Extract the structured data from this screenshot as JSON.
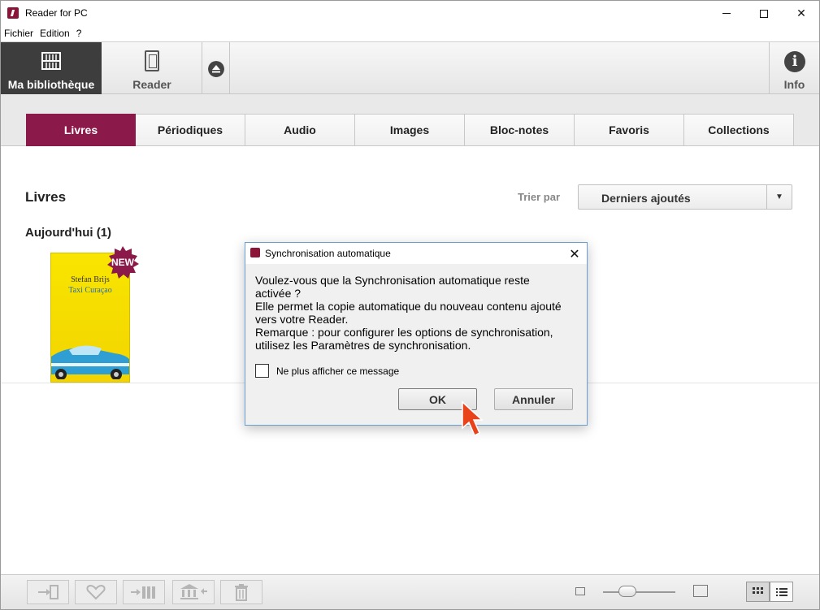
{
  "window": {
    "title": "Reader for PC"
  },
  "menu": {
    "items": [
      "Fichier",
      "Edition",
      "?"
    ]
  },
  "toolbar": {
    "library_label": "Ma bibliothèque",
    "reader_label": "Reader",
    "info_label": "Info"
  },
  "tabs": [
    "Livres",
    "Périodiques",
    "Audio",
    "Images",
    "Bloc-notes",
    "Favoris",
    "Collections"
  ],
  "content": {
    "section_title": "Livres",
    "sort_label": "Trier par",
    "sort_value": "Derniers ajoutés",
    "group_title": "Aujourd'hui (1)",
    "book": {
      "author": "Stefan Brijs",
      "title": "Taxi Curaçao",
      "badge": "NEW"
    }
  },
  "dialog": {
    "title": "Synchronisation automatique",
    "lines": [
      "Voulez-vous que la Synchronisation automatique reste",
      "activée ?",
      "Elle permet la copie automatique du nouveau contenu ajouté",
      "vers votre Reader.",
      "Remarque : pour configurer les options de synchronisation,",
      "utilisez les Paramètres de synchronisation."
    ],
    "checkbox_label": "Ne plus afficher ce message",
    "ok_label": "OK",
    "cancel_label": "Annuler"
  },
  "colors": {
    "accent": "#8b1a4a",
    "toolbar_active": "#3d3d3d",
    "dialog_border": "#6a9fd4"
  },
  "icons": {
    "bottom_bar": [
      "send-to-reader-icon",
      "favorite-heart-icon",
      "add-to-collection-icon",
      "move-to-library-icon",
      "trash-icon"
    ]
  }
}
